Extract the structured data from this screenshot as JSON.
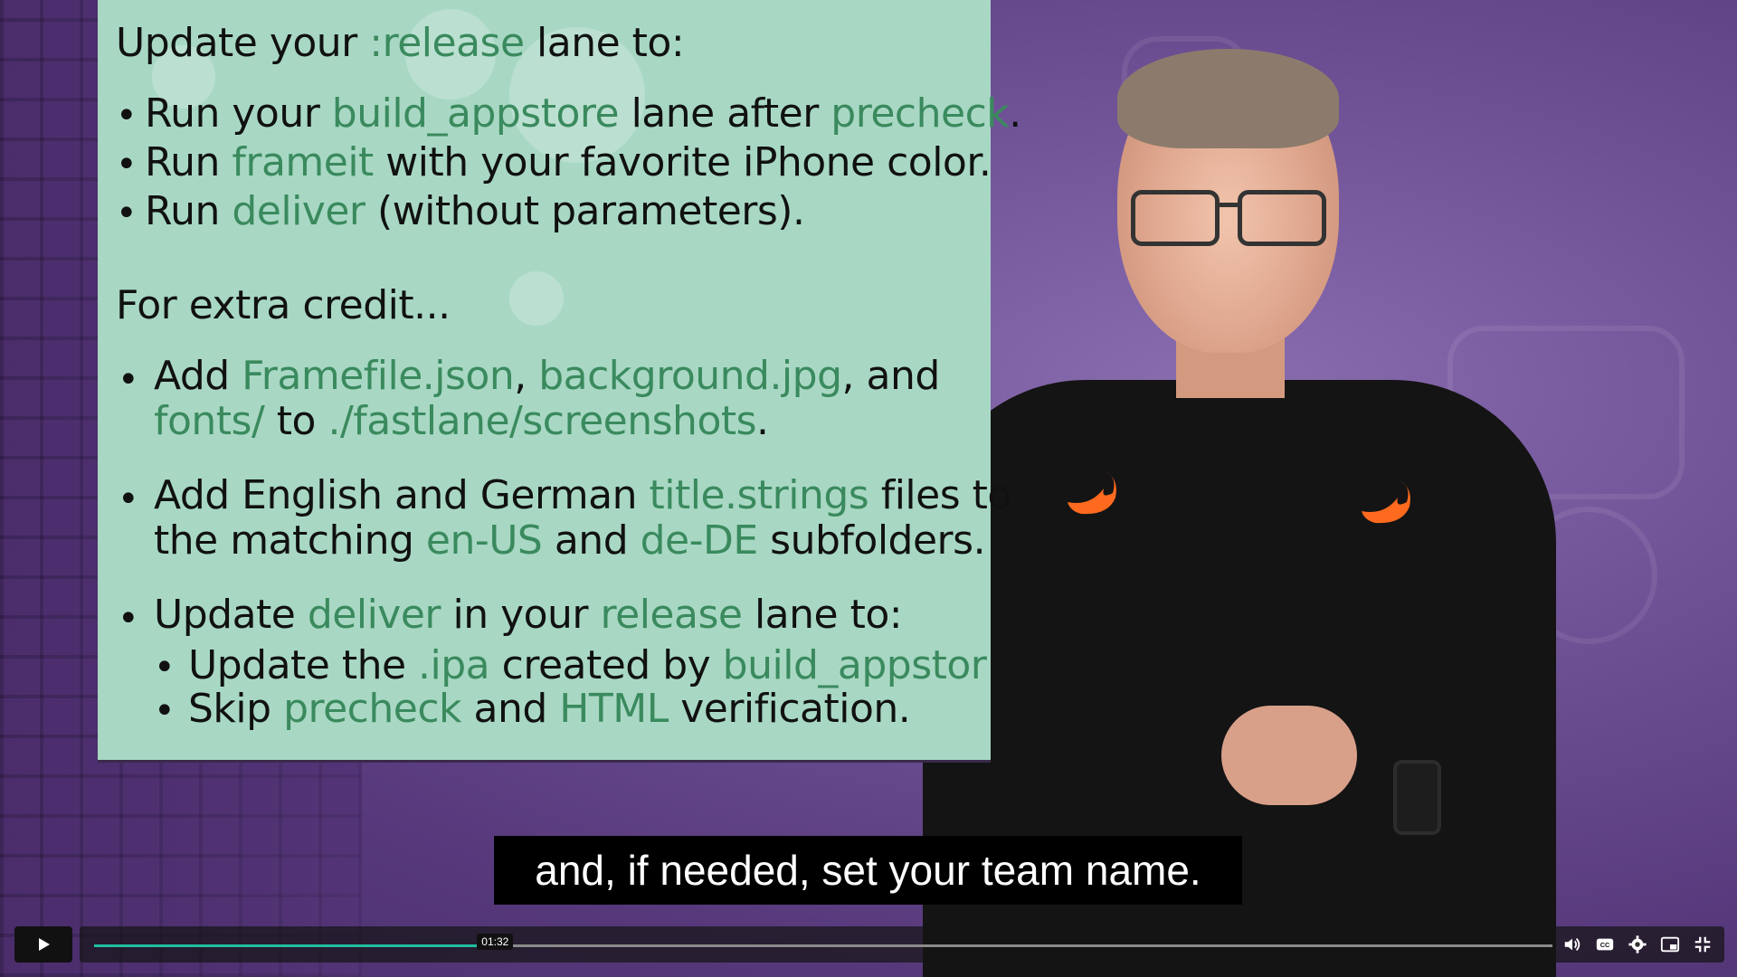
{
  "slide": {
    "heading1": [
      {
        "t": "Update your ",
        "code": false
      },
      {
        "t": ":release",
        "code": true
      },
      {
        "t": " lane to:",
        "code": false
      }
    ],
    "list1": [
      [
        {
          "t": "Run your ",
          "code": false
        },
        {
          "t": "build_appstore",
          "code": true
        },
        {
          "t": " lane after ",
          "code": false
        },
        {
          "t": "precheck",
          "code": true
        },
        {
          "t": ".",
          "code": false
        }
      ],
      [
        {
          "t": "Run ",
          "code": false
        },
        {
          "t": "frameit",
          "code": true
        },
        {
          "t": " with your favorite iPhone color.",
          "code": false
        }
      ],
      [
        {
          "t": "Run ",
          "code": false
        },
        {
          "t": "deliver",
          "code": true
        },
        {
          "t": " (without parameters).",
          "code": false
        }
      ]
    ],
    "heading2": "For extra credit...",
    "extra": [
      [
        [
          {
            "t": "Add ",
            "code": false
          },
          {
            "t": "Framefile.json",
            "code": true
          },
          {
            "t": ", ",
            "code": false
          },
          {
            "t": "background.jpg",
            "code": true
          },
          {
            "t": ", and",
            "code": false
          }
        ],
        [
          {
            "t": "fonts/",
            "code": true
          },
          {
            "t": " to ",
            "code": false
          },
          {
            "t": "./fastlane/screenshots",
            "code": true
          },
          {
            "t": ".",
            "code": false
          }
        ]
      ],
      [
        [
          {
            "t": "Add English and German ",
            "code": false
          },
          {
            "t": "title.strings",
            "code": true
          },
          {
            "t": " files to",
            "code": false
          }
        ],
        [
          {
            "t": "the matching ",
            "code": false
          },
          {
            "t": "en-US",
            "code": true
          },
          {
            "t": " and ",
            "code": false
          },
          {
            "t": "de-DE",
            "code": true
          },
          {
            "t": " subfolders.",
            "code": false
          }
        ]
      ],
      [
        [
          {
            "t": "Update ",
            "code": false
          },
          {
            "t": "deliver",
            "code": true
          },
          {
            "t": " in your ",
            "code": false
          },
          {
            "t": "release",
            "code": true
          },
          {
            "t": " lane to:",
            "code": false
          }
        ]
      ]
    ],
    "sublist": [
      [
        {
          "t": "Update the ",
          "code": false
        },
        {
          "t": ".ipa",
          "code": true
        },
        {
          "t": " created by ",
          "code": false
        },
        {
          "t": "build_appstor",
          "code": true
        }
      ],
      [
        {
          "t": "Skip ",
          "code": false
        },
        {
          "t": "precheck",
          "code": true
        },
        {
          "t": " and ",
          "code": false
        },
        {
          "t": "HTML",
          "code": true
        },
        {
          "t": " verification.",
          "code": false
        }
      ]
    ]
  },
  "caption": "and, if needed, set your team name.",
  "player": {
    "time_tooltip": "01:32",
    "progress": 0.275,
    "accent": "#1fbfa0",
    "icons": [
      "volume-icon",
      "captions-icon",
      "settings-icon",
      "pip-icon",
      "exit-fullscreen-icon"
    ]
  },
  "colors": {
    "slide_bg": "#a8d8c4",
    "code_text": "#3a8a5e",
    "swift_orange": "#ff6a1e"
  }
}
